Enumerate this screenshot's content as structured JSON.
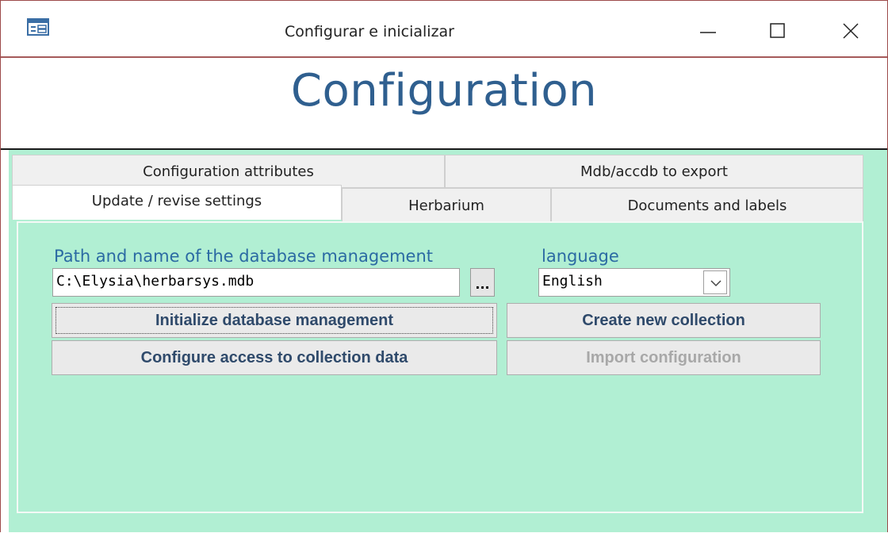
{
  "window": {
    "title": "Configurar e inicializar",
    "icon": "form-icon",
    "controls": [
      "minimize-icon",
      "maximize-icon",
      "close-icon"
    ]
  },
  "header": {
    "heading": "Configuration"
  },
  "tabs": {
    "row1": [
      {
        "label": "Configuration attributes"
      },
      {
        "label": "Mdb/accdb to export"
      }
    ],
    "row2": [
      {
        "label": "Update / revise settings",
        "active": true
      },
      {
        "label": "Herbarium"
      },
      {
        "label": "Documents and labels"
      }
    ]
  },
  "panel": {
    "path_label": "Path and name of the database management",
    "path_value": "C:\\Elysia\\herbarsys.mdb",
    "browse_label": "...",
    "language_label": "language",
    "language_value": "English",
    "buttons": {
      "initialize": "Initialize database management",
      "configure_access": "Configure access to collection data",
      "create_collection": "Create new collection",
      "import_config": "Import configuration"
    }
  },
  "colors": {
    "panel_bg": "#b1efd3",
    "label_blue": "#2b6aa3",
    "heading_blue": "#2f5f8f",
    "button_text": "#2f4a6b",
    "disabled_text": "#a8a8a8",
    "window_border": "#9c4a4a"
  }
}
